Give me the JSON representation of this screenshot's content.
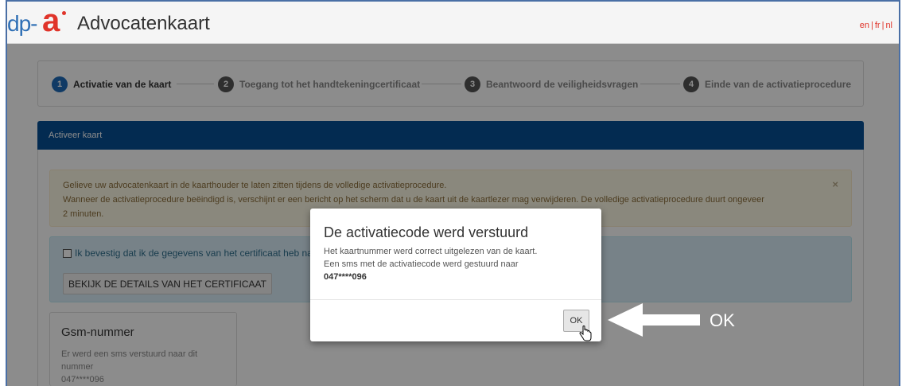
{
  "header": {
    "logo_text_dp": "dp-",
    "logo_text_a": "a",
    "app_title": "Advocatenkaart",
    "lang": [
      "en",
      "fr",
      "nl"
    ],
    "lang_sep": "|"
  },
  "steps": [
    {
      "num": "1",
      "label": "Activatie van de kaart",
      "active": true
    },
    {
      "num": "2",
      "label": "Toegang tot het handtekeningcertificaat",
      "active": false
    },
    {
      "num": "3",
      "label": "Beantwoord de veiligheidsvragen",
      "active": false
    },
    {
      "num": "4",
      "label": "Einde van de activatieprocedure",
      "active": false
    }
  ],
  "panel": {
    "title": "Activeer kaart"
  },
  "alert_warning": {
    "line1": "Gelieve uw advocatenkaart in de kaarthouder te laten zitten tijdens de volledige activatieprocedure.",
    "line2": "Wanneer de activatieprocedure beëindigd is, verschijnt er een bericht op het scherm dat u de kaart uit de kaartlezer mag verwijderen. De volledige activatieprocedure duurt ongeveer",
    "line3": "2 minuten.",
    "close": "×"
  },
  "alert_info": {
    "checkbox_label": "Ik bevestig dat ik de gegevens van het certificaat heb nag",
    "details_button": "BEKIJK DE DETAILS VAN HET CERTIFICAAT"
  },
  "gsm": {
    "heading": "Gsm-nummer",
    "text": "Er werd een sms verstuurd naar dit nummer",
    "number": "047****096"
  },
  "modal": {
    "title": "De activatiecode werd verstuurd",
    "line1": "Het kaartnummer werd correct uitgelezen van de kaart.",
    "line2": "Een sms met de activatiecode werd gestuurd naar",
    "number": "047****096",
    "ok_button": "OK"
  },
  "annotation": {
    "label": "OK"
  },
  "colors": {
    "brand_blue": "#064f94",
    "step_active": "#1e6bb8",
    "accent_red": "#e0342a"
  }
}
